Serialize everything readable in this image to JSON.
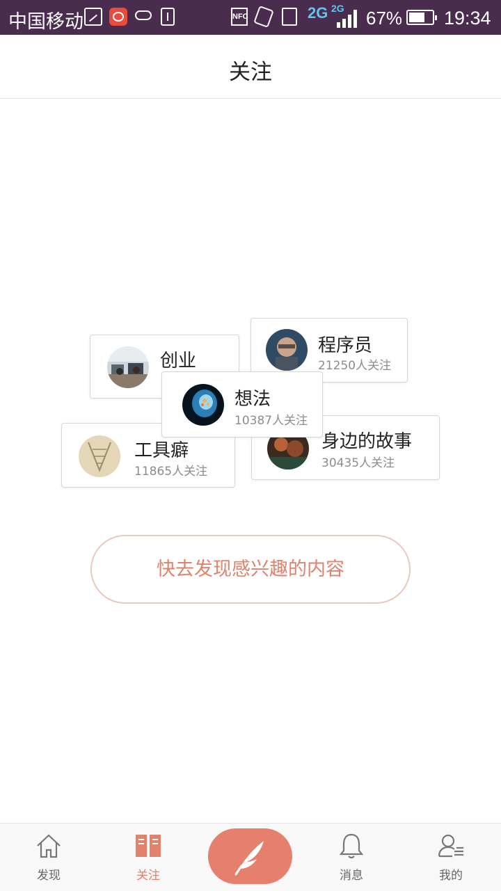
{
  "status_bar": {
    "carrier": "中国移动",
    "nfc": "NFC",
    "network_primary": "2G",
    "network_secondary": "2G",
    "battery": "67%",
    "time": "19:34",
    "icons": [
      "image-icon",
      "wechat-icon",
      "cloud-icon",
      "upload-icon",
      "nfc-icon",
      "rotate-icon",
      "sim-icon",
      "signal-icon",
      "battery-icon"
    ]
  },
  "header": {
    "title": "关注"
  },
  "topics": [
    {
      "name": "创业",
      "followers": ""
    },
    {
      "name": "程序员",
      "followers": "21250人关注"
    },
    {
      "name": "想法",
      "followers": "10387人关注"
    },
    {
      "name": "工具癖",
      "followers": "11865人关注"
    },
    {
      "name": "身边的故事",
      "followers": "30435人关注"
    }
  ],
  "cta": {
    "label": "快去发现感兴趣的内容"
  },
  "tabbar": {
    "items": [
      {
        "label": "发现",
        "icon": "home-icon"
      },
      {
        "label": "关注",
        "icon": "book-icon",
        "active": true
      },
      {
        "label": "",
        "icon": "quill-icon"
      },
      {
        "label": "消息",
        "icon": "bell-icon"
      },
      {
        "label": "我的",
        "icon": "profile-icon"
      }
    ]
  },
  "colors": {
    "accent": "#e0826c",
    "status_bar": "#4a2c4e",
    "cta_border": "#ecc7bd"
  }
}
